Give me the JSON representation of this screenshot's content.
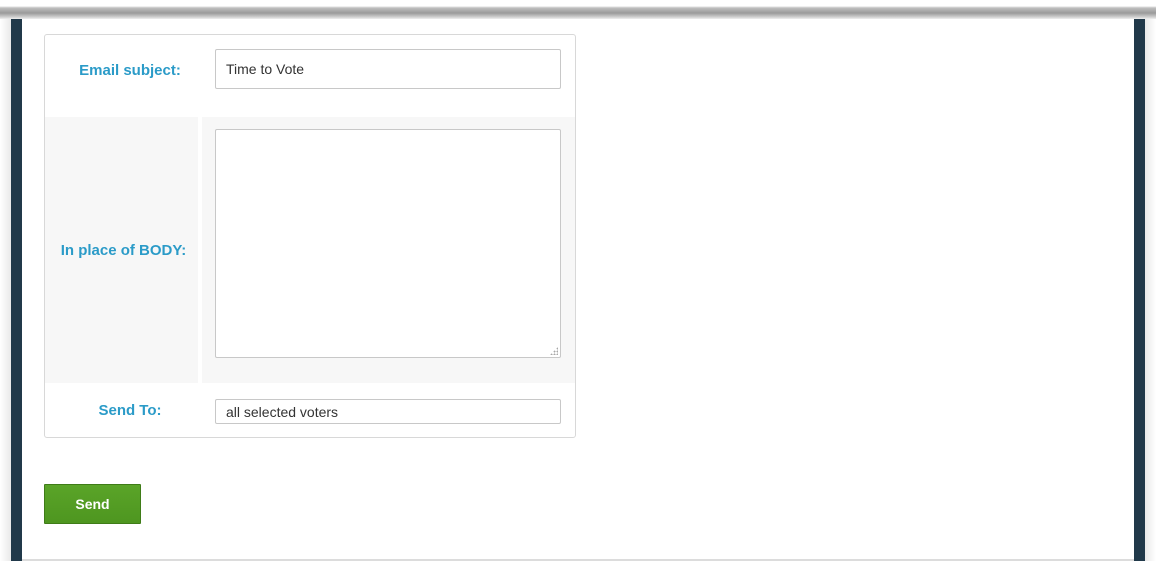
{
  "form": {
    "email_subject_label": "Email subject:",
    "email_subject_value": "Time to Vote",
    "body_label": "In place of BODY:",
    "body_value": "",
    "send_to_label": "Send To:",
    "send_to_value": "all selected voters"
  },
  "actions": {
    "send_label": "Send"
  },
  "colors": {
    "label": "#2b9bc8",
    "button": "#4e9620",
    "frame": "#21394a"
  }
}
